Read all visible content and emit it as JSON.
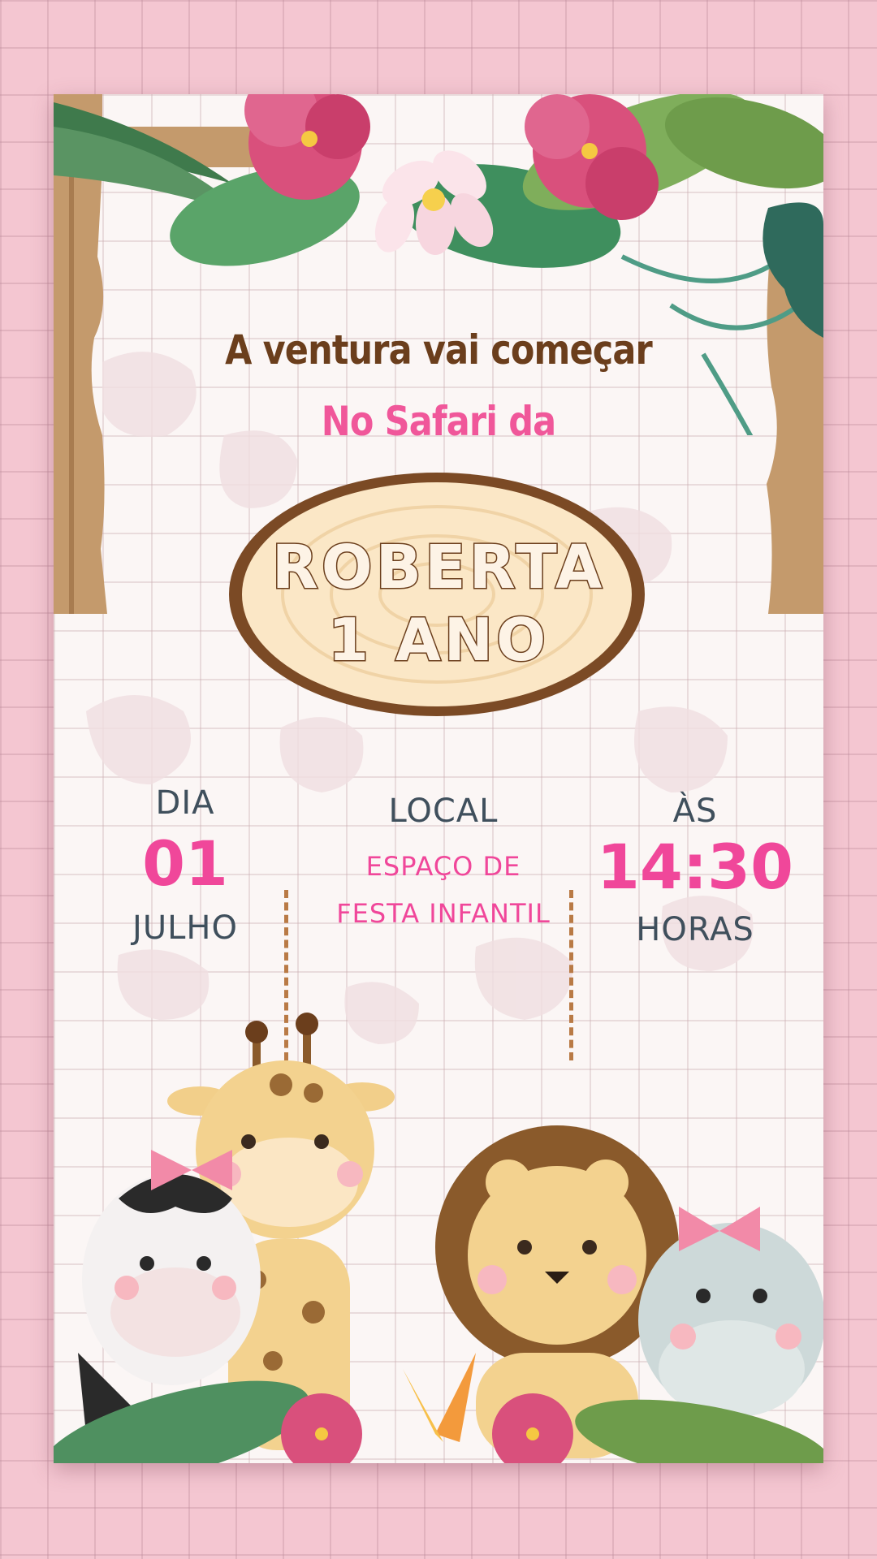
{
  "invitation": {
    "headline": "A ventura vai começar",
    "subheadline": "No Safari da",
    "plaque": {
      "name": "ROBERTA",
      "age": "1 ANO"
    },
    "date": {
      "label": "DIA",
      "day": "01",
      "month": "JULHO"
    },
    "location": {
      "label": "LOCAL",
      "line1": "ESPAÇO DE",
      "line2": "FESTA INFANTIL"
    },
    "time": {
      "label": "ÀS",
      "value": "14:30",
      "unit": "HORAS"
    }
  },
  "colors": {
    "background_pink": "#f4c6d1",
    "card": "#fbf6f5",
    "brown_text": "#6b3e1c",
    "pink_accent": "#f0479a",
    "slate_text": "#3f4f5c",
    "divider": "#b97a45"
  },
  "illustrations": [
    "hibiscus-flower-icon",
    "plumeria-flower-icon",
    "palm-leaf-icon",
    "wooden-frame-icon",
    "wood-slice-plaque-icon",
    "zebra-icon",
    "giraffe-icon",
    "lion-icon",
    "hippo-icon"
  ]
}
